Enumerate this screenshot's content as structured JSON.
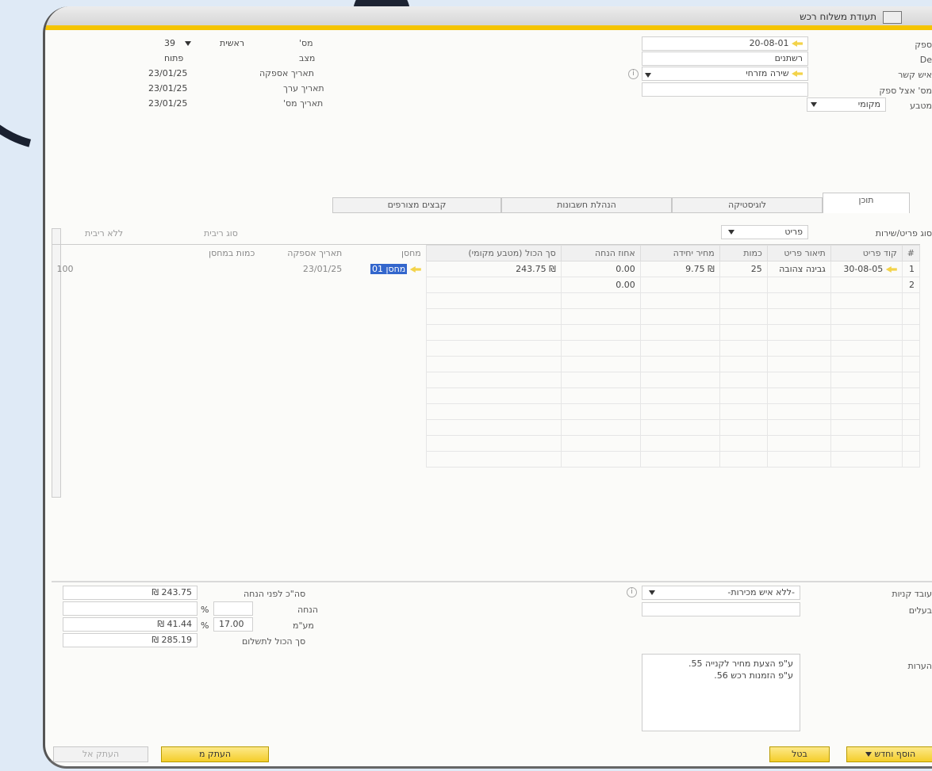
{
  "window": {
    "title": "תעודת משלוח רכש"
  },
  "header_right": {
    "vendor_code_label": "ספק",
    "vendor_code_value": "20-08-01",
    "name_label": "De",
    "name_value": "רשתנים",
    "contact_label": "איש קשר",
    "contact_value": "שירה מזרחי",
    "vendor_ref_label": "מס' אצל ספק",
    "currency_label": "מטבע",
    "currency_value": "מקומי"
  },
  "header_left": {
    "number_label": "מס'",
    "number_series": "ראשית",
    "number_value": "39",
    "status_label": "מצב",
    "status_value": "פתוח",
    "delivery_date_label": "תאריך אספקה",
    "delivery_date_value": "23/01/25",
    "doc_date_label": "תאריך ערך",
    "doc_date_value": "23/01/25",
    "posting_date_label": "תאריך מס'",
    "posting_date_value": "23/01/25"
  },
  "tabs": [
    "תוכן",
    "לוגיסטיקה",
    "הנהלת חשבונות",
    "קבצים מצורפים"
  ],
  "item_type": {
    "label": "סוג פריט/שירות",
    "value": "פריט"
  },
  "grid": {
    "columns": [
      "#",
      "קוד פריט",
      "תיאור פריט",
      "כמות",
      "מחיר יחידה",
      "אחוז הנחה",
      "סך הכול (מטבע מקומי)",
      "מחסן",
      "תאריך אספקה",
      "כמות במחסן"
    ],
    "extra_headers": [
      "סוג ריבית",
      "ללא ריבית"
    ],
    "rows": [
      {
        "num": "1",
        "item_code": "30-08-05",
        "description": "גבינה צהובה",
        "quantity": "25",
        "unit_price": "₪ 9.75",
        "discount": "0.00",
        "total": "₪ 243.75",
        "warehouse": "מחסן 01",
        "delivery_date": "23/01/25",
        "in_stock": "100"
      },
      {
        "num": "2",
        "item_code": "",
        "description": "",
        "quantity": "",
        "unit_price": "",
        "discount": "0.00",
        "total": "",
        "warehouse": "",
        "delivery_date": "",
        "in_stock": ""
      }
    ]
  },
  "footer_right": {
    "buyer_label": "עובד קניות",
    "buyer_value": "-ללא איש מכירות-",
    "owner_label": "בעלים",
    "remarks_label": "הערות",
    "remarks_lines": [
      "ע\"פ הצעת מחיר לקנייה 55.",
      "ע\"פ הזמנות רכש 56."
    ]
  },
  "footer_left": {
    "subtotal_label": "סה\"כ לפני הנחה",
    "subtotal_value": "₪ 243.75",
    "discount_label": "הנחה",
    "discount_pct": "%",
    "tax_label": "מע\"מ",
    "tax_rate": "17.00",
    "tax_value": "₪ 41.44",
    "total_label": "סך הכול לתשלום",
    "total_value": "₪ 285.19"
  },
  "buttons": {
    "add_label": "הוסף וחדש",
    "cancel_label": "בטל",
    "copy_from_label": "העתק מ",
    "copy_to_label": "העתק אל"
  }
}
